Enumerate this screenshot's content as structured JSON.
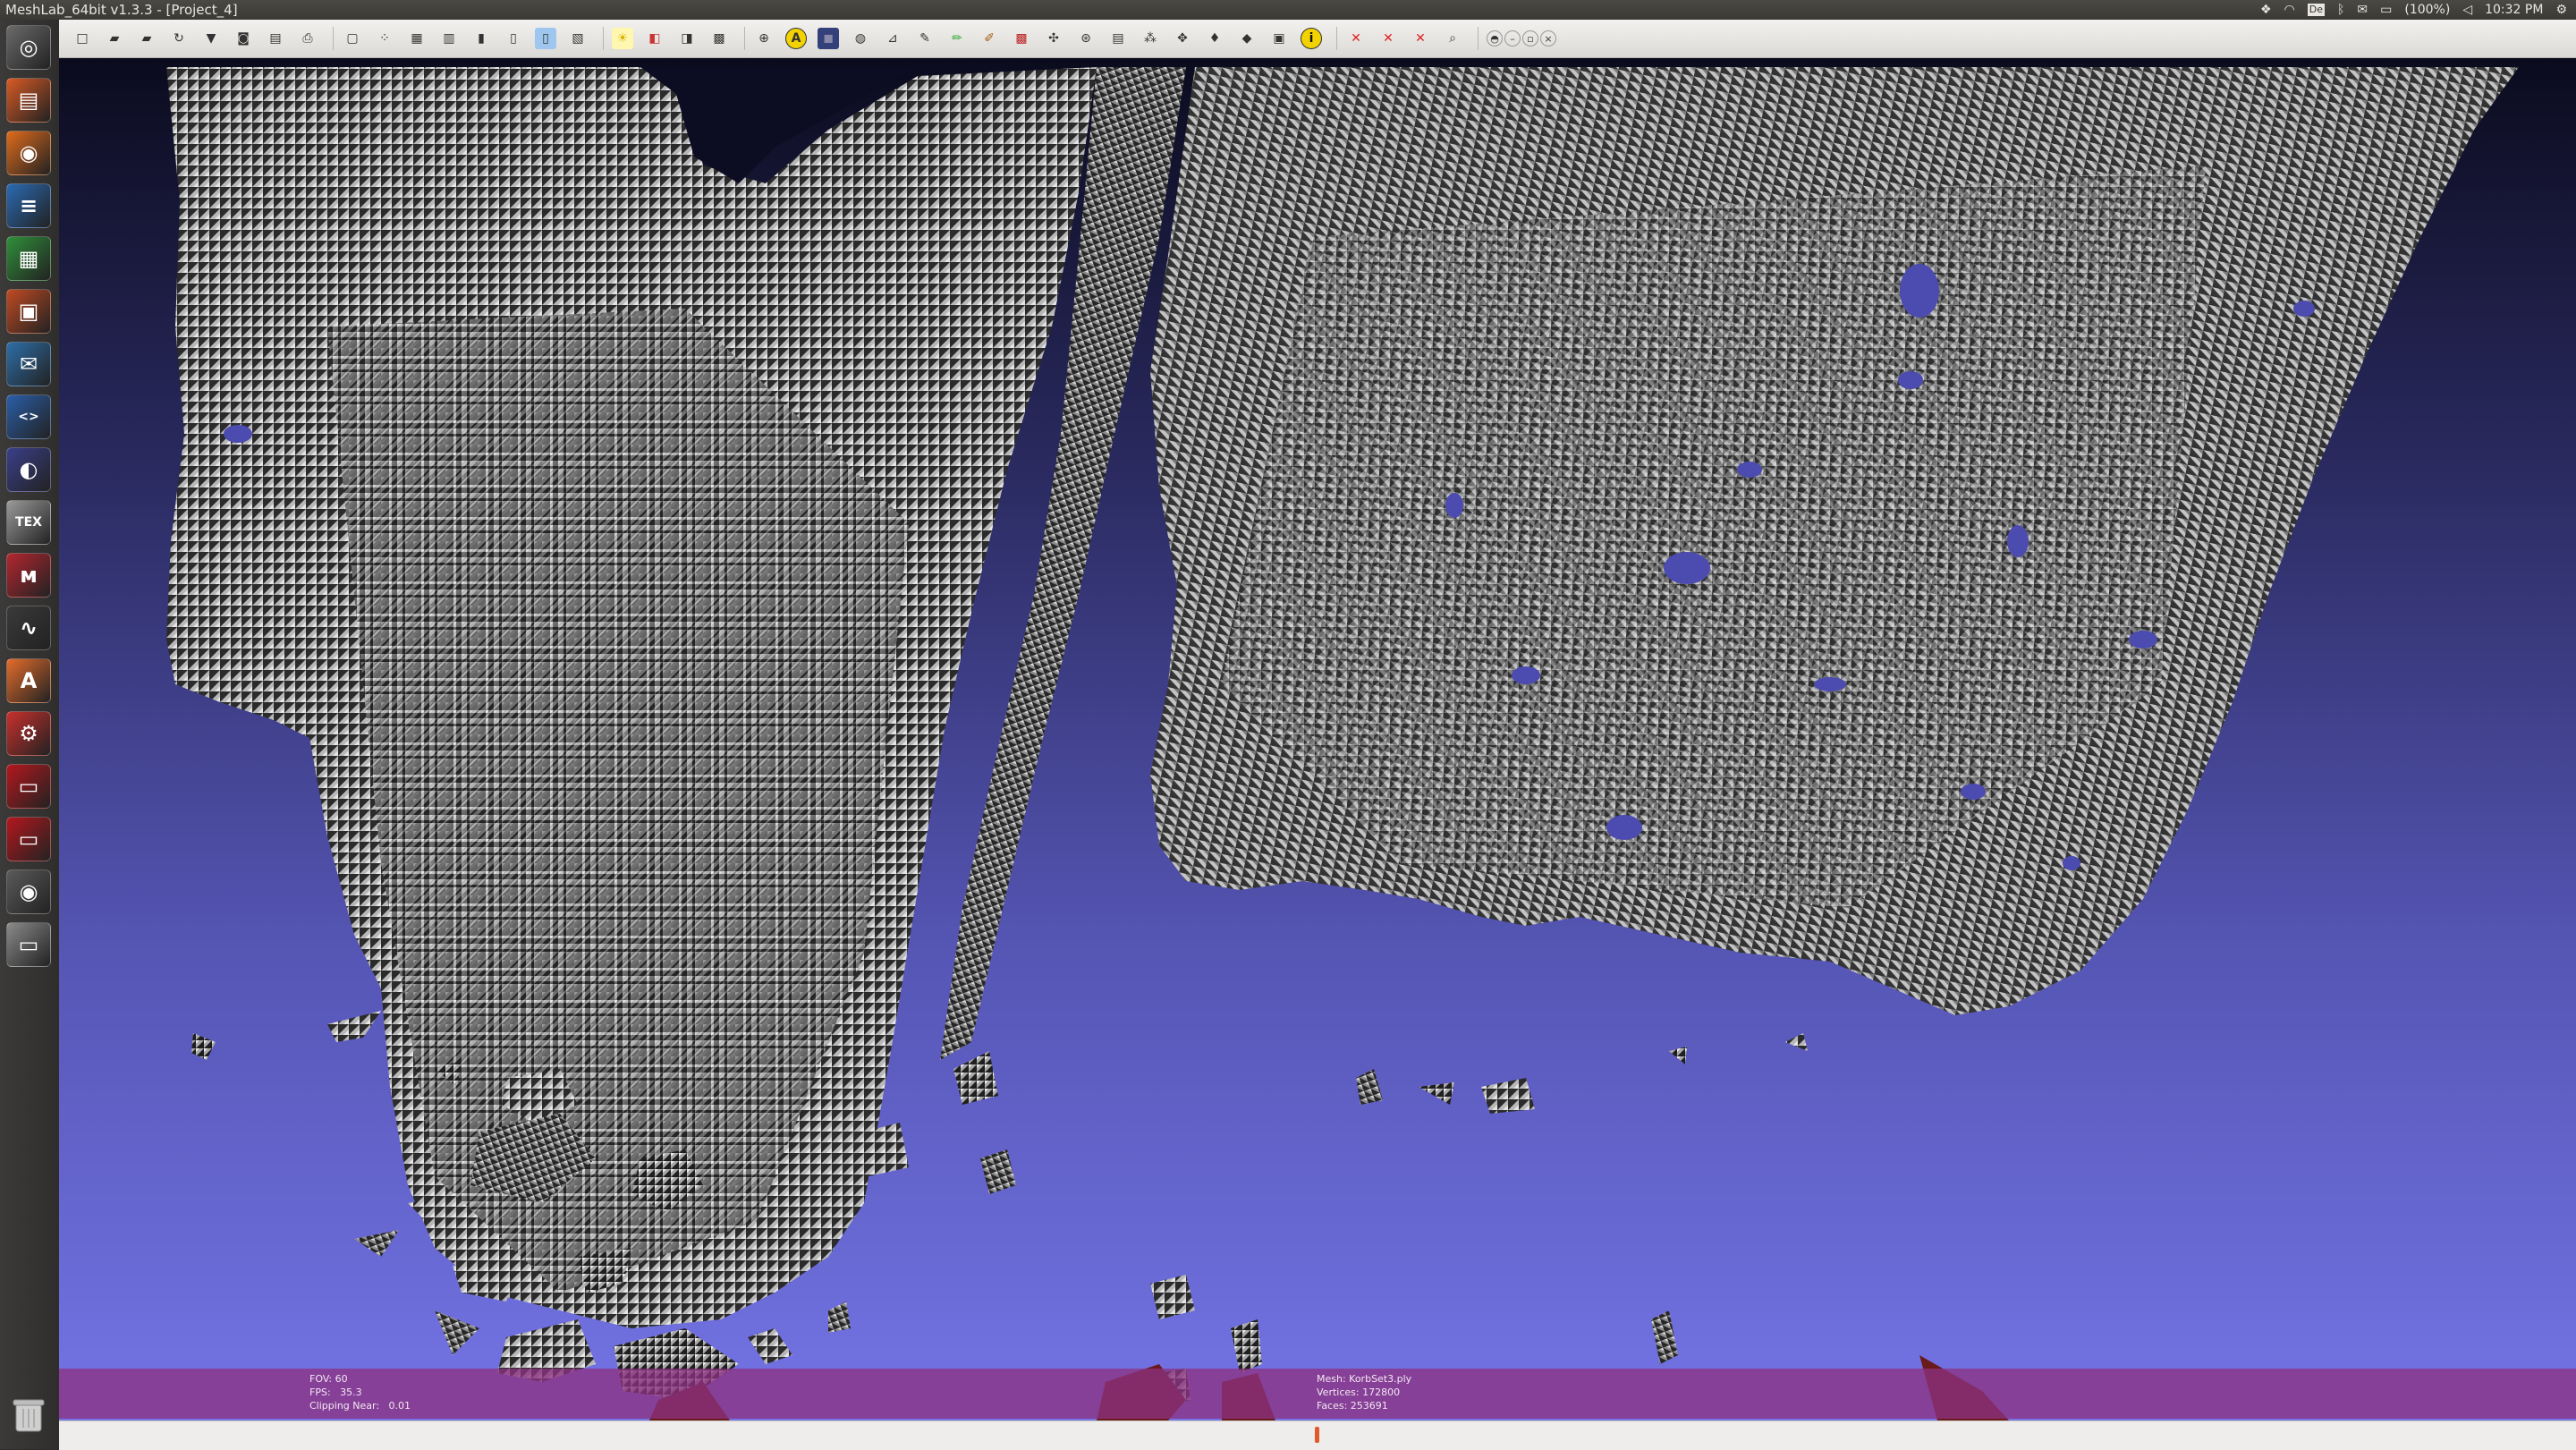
{
  "window": {
    "title": "MeshLab_64bit v1.3.3 - [Project_4]"
  },
  "tray": {
    "keyboard_layout": "De",
    "battery": "(100%)",
    "clock": "10:32 PM",
    "icons": [
      "dropbox-icon",
      "wifi-icon",
      "keyboard-icon",
      "bluetooth-icon",
      "mail-icon",
      "battery-icon",
      "volume-icon",
      "settings-gear-icon"
    ]
  },
  "launcher": {
    "items": [
      {
        "name": "dash-home-icon",
        "glyph": "◎",
        "color": "#6a6a6a"
      },
      {
        "name": "files-icon",
        "glyph": "▤",
        "color": "#d85a24"
      },
      {
        "name": "firefox-icon",
        "glyph": "◉",
        "color": "#e06b1b"
      },
      {
        "name": "writer-icon",
        "glyph": "≡",
        "color": "#2a6ab3"
      },
      {
        "name": "calc-icon",
        "glyph": "▦",
        "color": "#2f8f3a"
      },
      {
        "name": "impress-icon",
        "glyph": "▣",
        "color": "#c04a22"
      },
      {
        "name": "thunderbird-icon",
        "glyph": "✉",
        "color": "#2d6ea8"
      },
      {
        "name": "code-editor-icon",
        "glyph": "<>",
        "color": "#2a5ea8"
      },
      {
        "name": "eclipse-icon",
        "glyph": "◐",
        "color": "#3a3f8a"
      },
      {
        "name": "texmaker-icon",
        "glyph": "TEX",
        "color": "#9a9a9a"
      },
      {
        "name": "mendeley-icon",
        "glyph": "ᴍ",
        "color": "#b3262f"
      },
      {
        "name": "system-monitor-icon",
        "glyph": "∿",
        "color": "#3a3a3a"
      },
      {
        "name": "software-center-icon",
        "glyph": "A",
        "color": "#e36c2b"
      },
      {
        "name": "system-settings-icon",
        "glyph": "⚙",
        "color": "#c8302c"
      },
      {
        "name": "app-red-1-icon",
        "glyph": "▭",
        "color": "#b3171d"
      },
      {
        "name": "app-red-2-icon",
        "glyph": "▭",
        "color": "#b3171d"
      },
      {
        "name": "eye-app-icon",
        "glyph": "◉",
        "color": "#5a5a5a"
      },
      {
        "name": "drive-icon",
        "glyph": "▭",
        "color": "#8a8a8a"
      }
    ],
    "trash": "trash-icon"
  },
  "toolbar": {
    "buttons": [
      "new-project-icon",
      "open-project-icon",
      "open-mesh-icon",
      "reload-icon",
      "save-icon",
      "snapshot-icon",
      "export-icon",
      "print-icon",
      "bounding-box-icon",
      "points-icon",
      "wireframe-icon",
      "hidden-lines-icon",
      "flat-icon",
      "flat-lines-icon",
      "smooth-icon",
      "texture-icon",
      "light-on-icon",
      "double-side-lighting-icon",
      "fancy-lighting-icon",
      "back-face-icon",
      "trackball-icon",
      "annotation-icon",
      "shader-icon",
      "globe-icon",
      "select-faces-icon",
      "measure-tool-icon",
      "paint-icon",
      "brush-icon",
      "pick-points-icon",
      "align-icon",
      "manual-register-icon",
      "texture-paint-icon",
      "select-vertex-icon",
      "select-connected-icon",
      "z-paint-icon",
      "quality-map-icon",
      "raster-layer-icon",
      "info-icon",
      "delete-faces-icon",
      "delete-vertices-icon",
      "delete-selection-icon",
      "zoom-icon",
      "dock-float-icon",
      "dock-minimize-icon",
      "dock-restore-icon",
      "dock-close-icon"
    ]
  },
  "info": {
    "left": [
      "FOV: 60",
      "FPS:   35.3",
      "Clipping Near:   0.01"
    ],
    "right": [
      "Mesh: KorbSet3.ply",
      "Vertices: 172800",
      "Faces: 253691"
    ]
  },
  "status": {
    "progress": 0.0
  },
  "colors": {
    "background_top": "#0b0b1e",
    "background_bottom": "#7474e6",
    "info_bar": "#8c3282",
    "mesh_light": "#c9c9c9",
    "mesh_dark": "#2a2a2a"
  }
}
